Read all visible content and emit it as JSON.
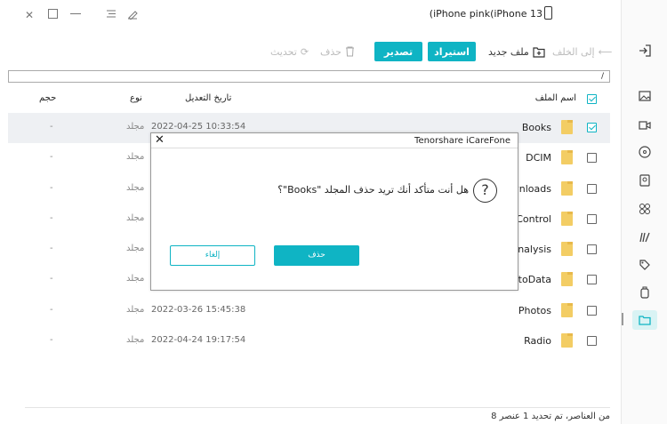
{
  "window": {
    "device_name": "(iPhone pink(iPhone 13",
    "controls": [
      "close-icon",
      "maximize-icon",
      "minimize-icon",
      "menu-icon",
      "feedback-icon"
    ]
  },
  "toolbar": {
    "back_label": "إلى الخلف",
    "new_folder_label": "ملف جديد",
    "import_label": "استيراد",
    "export_label": "تصدير",
    "delete_label": "حذف",
    "refresh_label": "تحديث"
  },
  "path": "/",
  "table": {
    "headers": {
      "name": "اسم الملف",
      "modified": "تاريخ التعديل",
      "type": "نوع",
      "size": "حجم"
    },
    "rows": [
      {
        "name": "Books",
        "date": "2022-04-25 10:33:54",
        "type": "مجلد",
        "size": "-",
        "checked": true
      },
      {
        "name": "DCIM",
        "date": "",
        "type": "مجلد",
        "size": "-",
        "checked": false
      },
      {
        "name": "wnloads",
        "date": "",
        "type": "مجلد",
        "size": "-",
        "checked": false
      },
      {
        "name": "s_Control",
        "date": "",
        "type": "مجلد",
        "size": "-",
        "checked": false
      },
      {
        "name": "aAnalysis",
        "date": "",
        "type": "مجلد",
        "size": "-",
        "checked": false
      },
      {
        "name": "otoData",
        "date": "",
        "type": "مجلد",
        "size": "-",
        "checked": false
      },
      {
        "name": "Photos",
        "date": "2022-03-26 15:45:38",
        "type": "مجلد",
        "size": "-",
        "checked": false
      },
      {
        "name": "Radio",
        "date": "2022-04-24 19:17:54",
        "type": "مجلد",
        "size": "-",
        "checked": false
      }
    ]
  },
  "status": "8 من العناصر، تم تحديد 1 عنصر",
  "dialog": {
    "title": "Tenorshare iCareFone",
    "message": "هل أنت متأكد أنك تريد حذف المجلد \"Books\"؟",
    "confirm_label": "حذف",
    "cancel_label": "إلغاء"
  },
  "colors": {
    "accent": "#0fb4c4",
    "folder": "#f3cd64",
    "selected_row": "#eef0f3"
  }
}
